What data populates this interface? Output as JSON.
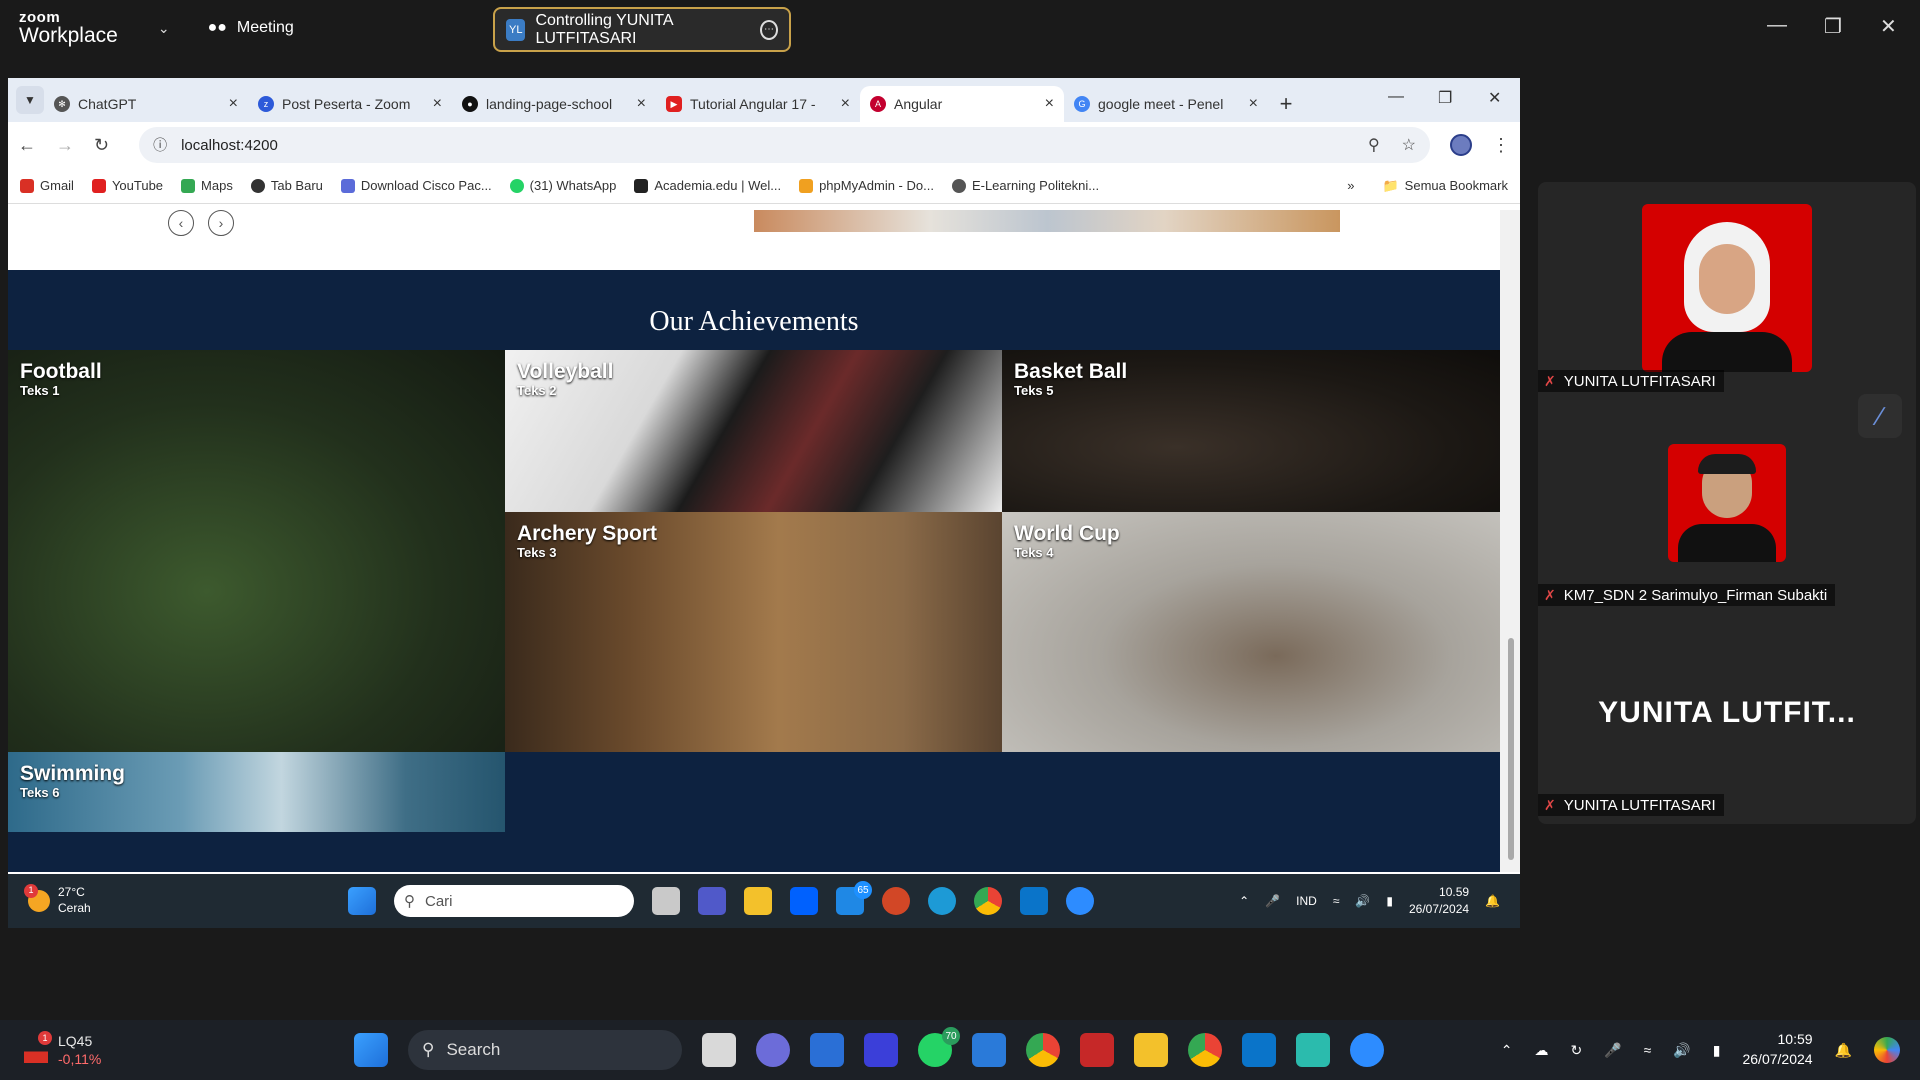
{
  "zoom": {
    "brand_small": "zoom",
    "brand": "Workplace",
    "meeting": "Meeting",
    "controlling_initials": "YL",
    "controlling": "Controlling YUNITA LUTFITASARI"
  },
  "browser": {
    "tabs": [
      {
        "label": "ChatGPT",
        "icon": "chatgpt-icon",
        "color": "#555555"
      },
      {
        "label": "Post Peserta - Zoom",
        "icon": "zoom-icon",
        "color": "#2d5ad9"
      },
      {
        "label": "landing-page-school",
        "icon": "github-icon",
        "color": "#111111"
      },
      {
        "label": "Tutorial Angular 17 -",
        "icon": "youtube-icon",
        "color": "#e02020"
      },
      {
        "label": "Angular",
        "icon": "angular-icon",
        "color": "#c3002f"
      },
      {
        "label": "google meet - Penel",
        "icon": "google-icon",
        "color": "#4285f4"
      }
    ],
    "url": "localhost:4200",
    "bookmarks": [
      {
        "label": "Gmail",
        "color": "#d93025"
      },
      {
        "label": "YouTube",
        "color": "#e02020"
      },
      {
        "label": "Maps",
        "color": "#34a853"
      },
      {
        "label": "Tab Baru",
        "color": "#333333"
      },
      {
        "label": "Download Cisco Pac...",
        "color": "#5b6bd9"
      },
      {
        "label": "(31) WhatsApp",
        "color": "#25d366"
      },
      {
        "label": "Academia.edu | Wel...",
        "color": "#222222"
      },
      {
        "label": "phpMyAdmin - Do...",
        "color": "#f0a020"
      },
      {
        "label": "E-Learning Politekni...",
        "color": "#555555"
      }
    ],
    "all_bookmarks": "Semua Bookmark"
  },
  "site": {
    "heading": "Our Achievements",
    "cards": [
      {
        "title": "Football",
        "sub": "Teks 1"
      },
      {
        "title": "Volleyball",
        "sub": "Teks 2"
      },
      {
        "title": "Basket Ball",
        "sub": "Teks 5"
      },
      {
        "title": "Archery Sport",
        "sub": "Teks 3"
      },
      {
        "title": "World Cup",
        "sub": "Teks 4"
      },
      {
        "title": "Swimming",
        "sub": "Teks 6"
      }
    ]
  },
  "inner_taskbar": {
    "badge": "1",
    "temp": "27°C",
    "weather": "Cerah",
    "search": "Cari",
    "mail_badge": "65",
    "lang": "IND",
    "time": "10.59",
    "date": "26/07/2024"
  },
  "participants": [
    {
      "name": "YUNITA LUTFITASARI"
    },
    {
      "name": "KM7_SDN 2 Sarimulyo_Firman Subakti"
    },
    {
      "name": "YUNITA LUTFITASARI",
      "big_label": "YUNITA  LUTFIT..."
    }
  ],
  "taskbar": {
    "stock_badge": "1",
    "stock": "LQ45",
    "stock_change": "-0,11%",
    "search": "Search",
    "wa_badge": "70",
    "time": "10:59",
    "date": "26/07/2024"
  }
}
